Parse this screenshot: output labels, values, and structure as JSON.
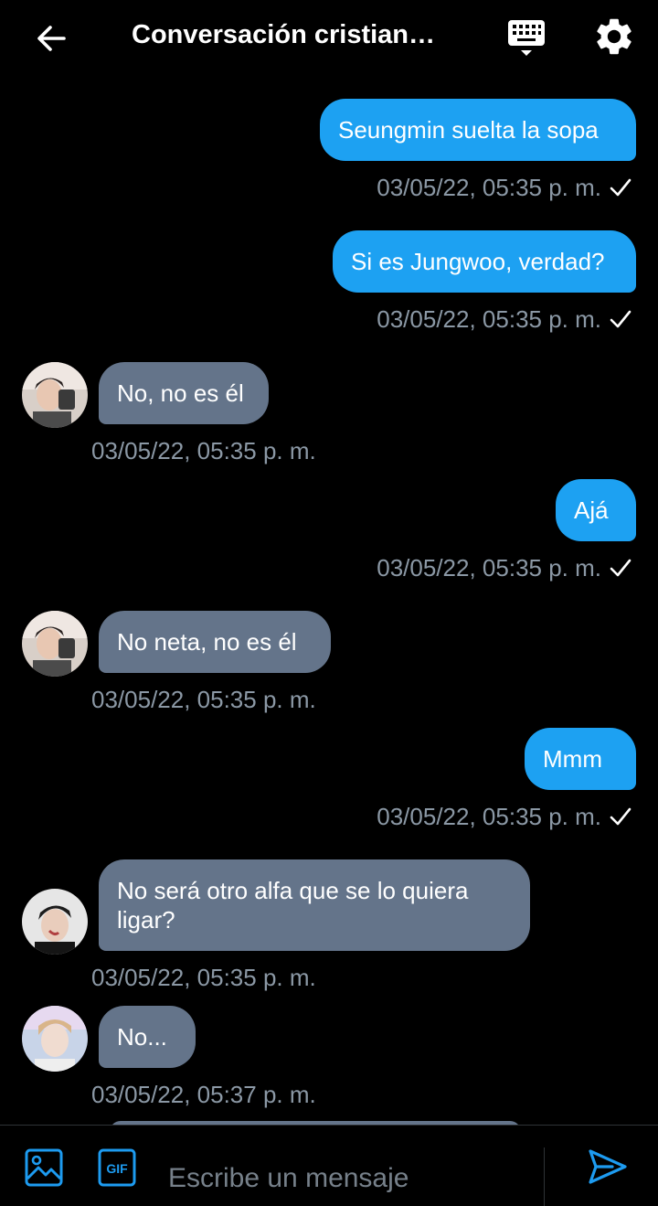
{
  "header": {
    "title": "Conversación cristian…",
    "back_icon": "arrow-left-icon",
    "keyboard_icon": "keyboard-icon",
    "settings_icon": "gear-icon"
  },
  "colors": {
    "background": "#000000",
    "outgoing_bubble": "#1da1f2",
    "incoming_bubble": "#64748a",
    "timestamp": "#8b98a5",
    "accent": "#1d9bf0"
  },
  "messages": [
    {
      "direction": "out",
      "text": "Seungmin suelta la sopa",
      "time": "03/05/22, 05:35 p. m.",
      "read_check": true
    },
    {
      "direction": "out",
      "text": "Si es Jungwoo, verdad?",
      "time": "03/05/22, 05:35 p. m.",
      "read_check": true
    },
    {
      "direction": "in",
      "text": "No, no es él",
      "time": "03/05/22, 05:35 p. m."
    },
    {
      "direction": "out",
      "text": "Ajá",
      "time": "03/05/22, 05:35 p. m.",
      "read_check": true
    },
    {
      "direction": "in",
      "text": "No neta, no es él",
      "time": "03/05/22, 05:35 p. m."
    },
    {
      "direction": "out",
      "text": "Mmm",
      "time": "03/05/22, 05:35 p. m.",
      "read_check": true
    },
    {
      "direction": "in",
      "text": "No será otro alfa que se lo quiera ligar?",
      "time": "03/05/22, 05:35 p. m."
    },
    {
      "direction": "in",
      "text": "No...",
      "time": "03/05/22, 05:37 p. m."
    }
  ],
  "composer": {
    "placeholder": "Escribe un mensaje",
    "media_icon": "image-icon",
    "gif_label": "GIF",
    "send_icon": "send-icon"
  }
}
